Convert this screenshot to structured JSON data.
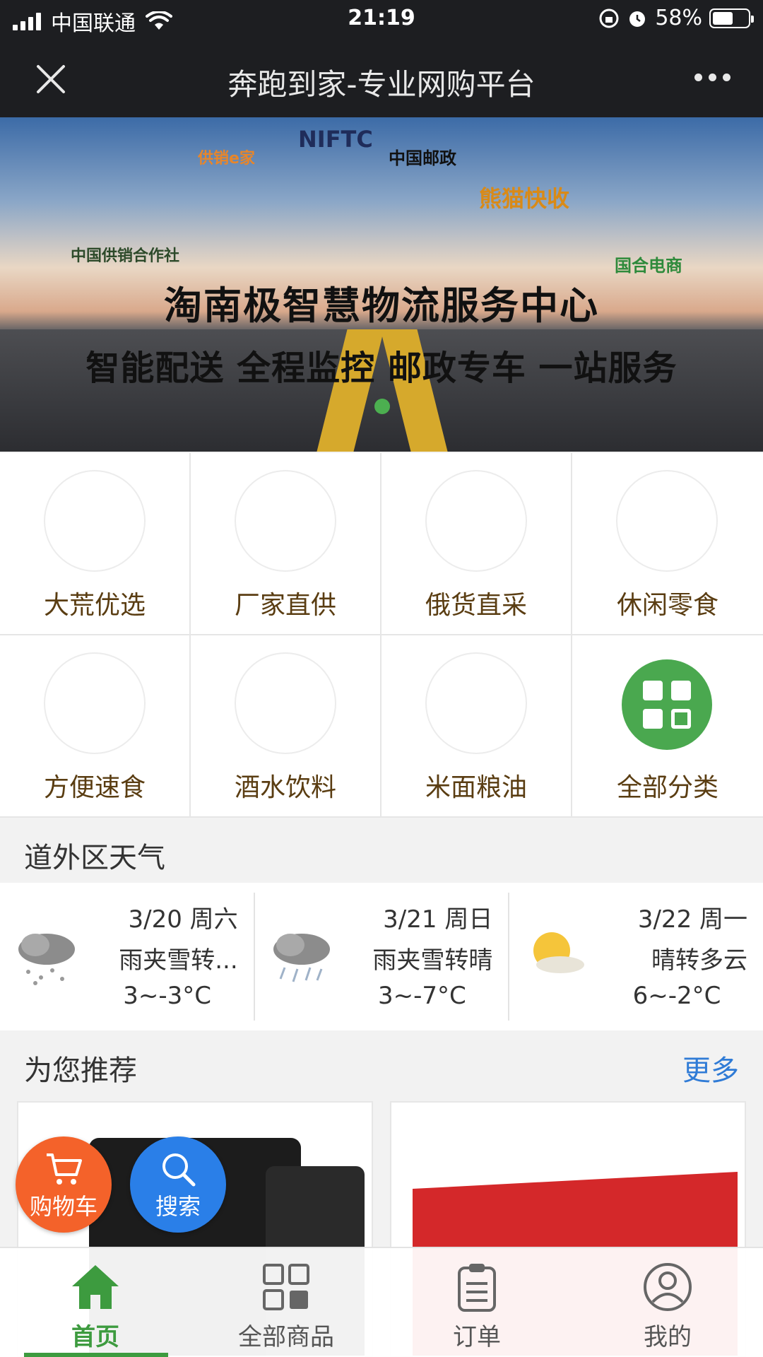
{
  "statusbar": {
    "carrier": "中国联通",
    "time": "21:19",
    "battery": "58%",
    "battery_level": 0.58
  },
  "titlebar": {
    "title": "奔跑到家-专业网购平台"
  },
  "banner": {
    "headline": "淘南极智慧物流服务中心",
    "subline": "智能配送 全程监控 邮政专车 一站服务",
    "logos": [
      "供销e家",
      "NIFTC",
      "中国邮政",
      "熊猫快收",
      "中国供销合作社",
      "国合电商"
    ],
    "active_slide": 1
  },
  "categories": [
    {
      "label": "大荒优选",
      "image": "vegetables"
    },
    {
      "label": "厂家直供",
      "image": "groceries"
    },
    {
      "label": "俄货直采",
      "image": "vegetables"
    },
    {
      "label": "休闲零食",
      "image": "snacks"
    },
    {
      "label": "方便速食",
      "image": "vegetables"
    },
    {
      "label": "酒水饮料",
      "image": "drinks"
    },
    {
      "label": "米面粮油",
      "image": "vegetables"
    },
    {
      "label": "全部分类",
      "image": "grid-icon"
    }
  ],
  "weather": {
    "title": "道外区天气",
    "days": [
      {
        "date": "3/20 周六",
        "desc": "雨夹雪转...",
        "temp": "3~-3°C",
        "icon": "snow-cloud-icon"
      },
      {
        "date": "3/21 周日",
        "desc": "雨夹雪转晴",
        "temp": "3~-7°C",
        "icon": "sleet-cloud-icon"
      },
      {
        "date": "3/22 周一",
        "desc": "晴转多云",
        "temp": "6~-2°C",
        "icon": "sun-cloud-icon"
      }
    ]
  },
  "recommend": {
    "title": "为您推荐",
    "more": "更多"
  },
  "fabs": {
    "cart": "购物车",
    "search": "搜索",
    "cart_color": "#f4622a",
    "search_color": "#2a7fe8"
  },
  "bottomnav": {
    "items": [
      {
        "label": "首页",
        "icon": "home-icon",
        "active": true
      },
      {
        "label": "全部商品",
        "icon": "grid-icon",
        "active": false
      },
      {
        "label": "订单",
        "icon": "clipboard-icon",
        "active": false
      },
      {
        "label": "我的",
        "icon": "user-icon",
        "active": false
      }
    ],
    "active_color": "#3d9b3f"
  }
}
